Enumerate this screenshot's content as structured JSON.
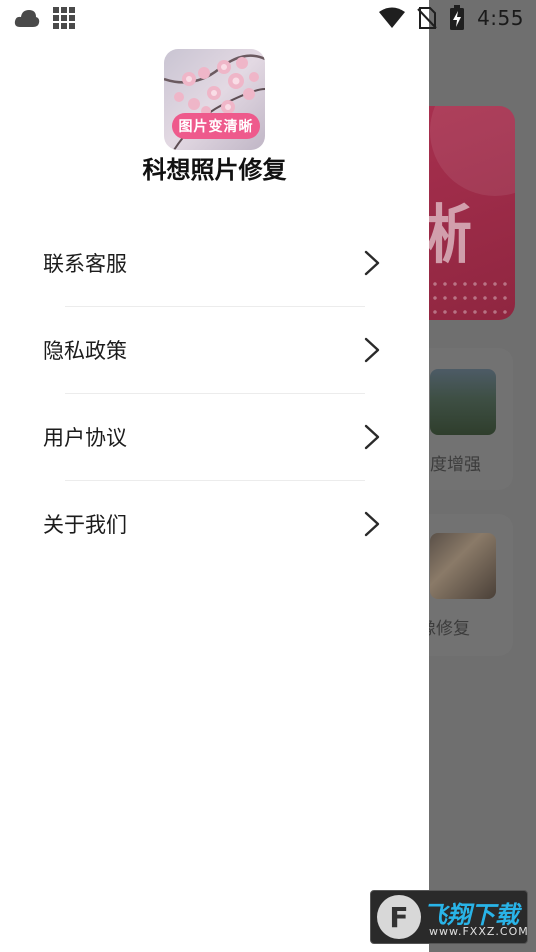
{
  "status_bar": {
    "time": "4:55",
    "icons": [
      "cloud-icon",
      "grid-icon",
      "wifi-icon",
      "no-sim-icon",
      "battery-charging-icon"
    ]
  },
  "drawer": {
    "app_icon": {
      "badge_text": "图片变清晰"
    },
    "app_name": "科想照片修复",
    "menu_items": [
      {
        "label": "联系客服"
      },
      {
        "label": "隐私政策"
      },
      {
        "label": "用户协议"
      },
      {
        "label": "关于我们"
      }
    ]
  },
  "background": {
    "banner_text": "晰",
    "cards": [
      {
        "label": "度增强"
      },
      {
        "label": "像修复"
      }
    ]
  },
  "watermark": {
    "title": "飞翔下载",
    "url": "www.FXXZ.COM"
  },
  "colors": {
    "drawer_bg": "#ffffff",
    "scrim": "#6f6f6f",
    "badge": "#ee5a8c"
  }
}
